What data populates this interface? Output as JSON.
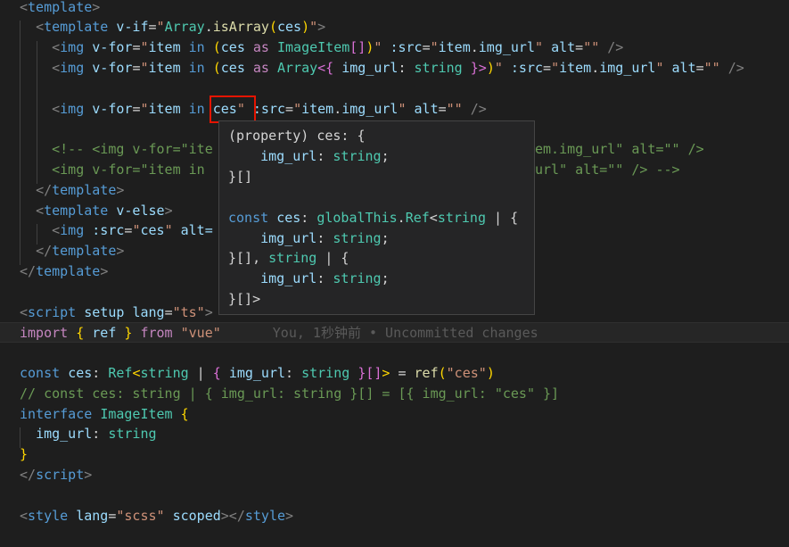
{
  "editor": {
    "lines": [
      [
        [
          "tok-pun",
          "<"
        ],
        [
          "tok-tag",
          "template"
        ],
        [
          "tok-pun",
          ">"
        ]
      ],
      [
        [
          "tok-plain",
          "  "
        ],
        [
          "tok-pun",
          "<"
        ],
        [
          "tok-tag",
          "template"
        ],
        [
          "tok-plain",
          " "
        ],
        [
          "tok-attr",
          "v-if"
        ],
        [
          "tok-plain",
          "="
        ],
        [
          "tok-str",
          "\""
        ],
        [
          "tok-type",
          "Array"
        ],
        [
          "tok-plain",
          "."
        ],
        [
          "tok-fn",
          "isArray"
        ],
        [
          "tok-br1",
          "("
        ],
        [
          "tok-attr",
          "ces"
        ],
        [
          "tok-br1",
          ")"
        ],
        [
          "tok-str",
          "\""
        ],
        [
          "tok-pun",
          ">"
        ]
      ],
      [
        [
          "tok-plain",
          "    "
        ],
        [
          "tok-pun",
          "<"
        ],
        [
          "tok-tag",
          "img"
        ],
        [
          "tok-plain",
          " "
        ],
        [
          "tok-attr",
          "v-for"
        ],
        [
          "tok-plain",
          "="
        ],
        [
          "tok-str",
          "\""
        ],
        [
          "tok-attr",
          "item"
        ],
        [
          "tok-plain",
          " "
        ],
        [
          "tok-kw2",
          "in"
        ],
        [
          "tok-plain",
          " "
        ],
        [
          "tok-br1",
          "("
        ],
        [
          "tok-attr",
          "ces"
        ],
        [
          "tok-plain",
          " "
        ],
        [
          "tok-kw",
          "as"
        ],
        [
          "tok-plain",
          " "
        ],
        [
          "tok-type",
          "ImageItem"
        ],
        [
          "tok-br2",
          "[]"
        ],
        [
          "tok-br1",
          ")"
        ],
        [
          "tok-str",
          "\""
        ],
        [
          "tok-plain",
          " "
        ],
        [
          "tok-attr",
          ":src"
        ],
        [
          "tok-plain",
          "="
        ],
        [
          "tok-str",
          "\""
        ],
        [
          "tok-attr",
          "item"
        ],
        [
          "tok-plain",
          "."
        ],
        [
          "tok-attr",
          "img_url"
        ],
        [
          "tok-str",
          "\""
        ],
        [
          "tok-plain",
          " "
        ],
        [
          "tok-attr",
          "alt"
        ],
        [
          "tok-plain",
          "="
        ],
        [
          "tok-str",
          "\"\""
        ],
        [
          "tok-plain",
          " "
        ],
        [
          "tok-pun",
          "/>"
        ]
      ],
      [
        [
          "tok-plain",
          "    "
        ],
        [
          "tok-pun",
          "<"
        ],
        [
          "tok-tag",
          "img"
        ],
        [
          "tok-plain",
          " "
        ],
        [
          "tok-attr",
          "v-for"
        ],
        [
          "tok-plain",
          "="
        ],
        [
          "tok-str",
          "\""
        ],
        [
          "tok-attr",
          "item"
        ],
        [
          "tok-plain",
          " "
        ],
        [
          "tok-kw2",
          "in"
        ],
        [
          "tok-plain",
          " "
        ],
        [
          "tok-br1",
          "("
        ],
        [
          "tok-attr",
          "ces"
        ],
        [
          "tok-plain",
          " "
        ],
        [
          "tok-kw",
          "as"
        ],
        [
          "tok-plain",
          " "
        ],
        [
          "tok-type",
          "Array"
        ],
        [
          "tok-br2",
          "<{"
        ],
        [
          "tok-plain",
          " "
        ],
        [
          "tok-attr",
          "img_url"
        ],
        [
          "tok-plain",
          ": "
        ],
        [
          "tok-type",
          "string"
        ],
        [
          "tok-plain",
          " "
        ],
        [
          "tok-br2",
          "}>"
        ],
        [
          "tok-br1",
          ")"
        ],
        [
          "tok-str",
          "\""
        ],
        [
          "tok-plain",
          " "
        ],
        [
          "tok-attr",
          ":src"
        ],
        [
          "tok-plain",
          "="
        ],
        [
          "tok-str",
          "\""
        ],
        [
          "tok-attr",
          "item"
        ],
        [
          "tok-plain",
          "."
        ],
        [
          "tok-attr",
          "img_url"
        ],
        [
          "tok-str",
          "\""
        ],
        [
          "tok-plain",
          " "
        ],
        [
          "tok-attr",
          "alt"
        ],
        [
          "tok-plain",
          "="
        ],
        [
          "tok-str",
          "\"\""
        ],
        [
          "tok-plain",
          " "
        ],
        [
          "tok-pun",
          "/>"
        ]
      ],
      [],
      [
        [
          "tok-plain",
          "    "
        ],
        [
          "tok-pun",
          "<"
        ],
        [
          "tok-tag",
          "img"
        ],
        [
          "tok-plain",
          " "
        ],
        [
          "tok-attr",
          "v-for"
        ],
        [
          "tok-plain",
          "="
        ],
        [
          "tok-str",
          "\""
        ],
        [
          "tok-attr",
          "item"
        ],
        [
          "tok-plain",
          " "
        ],
        [
          "tok-kw2",
          "in"
        ],
        [
          "tok-plain",
          " "
        ],
        [
          "tok-attr",
          "ces"
        ],
        [
          "tok-str",
          "\""
        ],
        [
          "tok-plain",
          " "
        ],
        [
          "tok-attr",
          ":src"
        ],
        [
          "tok-plain",
          "="
        ],
        [
          "tok-str",
          "\""
        ],
        [
          "tok-attr",
          "item"
        ],
        [
          "tok-plain",
          "."
        ],
        [
          "tok-attr",
          "img_url"
        ],
        [
          "tok-str",
          "\""
        ],
        [
          "tok-plain",
          " "
        ],
        [
          "tok-attr",
          "alt"
        ],
        [
          "tok-plain",
          "="
        ],
        [
          "tok-str",
          "\"\""
        ],
        [
          "tok-plain",
          " "
        ],
        [
          "tok-pun",
          "/>"
        ]
      ],
      [],
      [
        [
          "tok-plain",
          "    "
        ],
        [
          "tok-cmt",
          "<!-- <img v-for=\"ite"
        ],
        [
          "tok-plain",
          "                                 "
        ],
        [
          "tok-cmt",
          "src=\"item.img_url\" alt=\"\" />"
        ]
      ],
      [
        [
          "tok-plain",
          "    "
        ],
        [
          "tok-cmt",
          "<img v-for=\"item in "
        ],
        [
          "tok-plain",
          "                                 "
        ],
        [
          "tok-cmt",
          "em.img_url\" alt=\"\" /> -->"
        ]
      ],
      [
        [
          "tok-plain",
          "  "
        ],
        [
          "tok-pun",
          "</"
        ],
        [
          "tok-tag",
          "template"
        ],
        [
          "tok-pun",
          ">"
        ]
      ],
      [
        [
          "tok-plain",
          "  "
        ],
        [
          "tok-pun",
          "<"
        ],
        [
          "tok-tag",
          "template"
        ],
        [
          "tok-plain",
          " "
        ],
        [
          "tok-attr",
          "v-else"
        ],
        [
          "tok-pun",
          ">"
        ]
      ],
      [
        [
          "tok-plain",
          "    "
        ],
        [
          "tok-pun",
          "<"
        ],
        [
          "tok-tag",
          "img"
        ],
        [
          "tok-plain",
          " "
        ],
        [
          "tok-attr",
          ":src"
        ],
        [
          "tok-plain",
          "="
        ],
        [
          "tok-str",
          "\""
        ],
        [
          "tok-attr",
          "ces"
        ],
        [
          "tok-str",
          "\""
        ],
        [
          "tok-plain",
          " "
        ],
        [
          "tok-attr",
          "alt="
        ]
      ],
      [
        [
          "tok-plain",
          "  "
        ],
        [
          "tok-pun",
          "</"
        ],
        [
          "tok-tag",
          "template"
        ],
        [
          "tok-pun",
          ">"
        ]
      ],
      [
        [
          "tok-pun",
          "</"
        ],
        [
          "tok-tag",
          "template"
        ],
        [
          "tok-pun",
          ">"
        ]
      ],
      [],
      [
        [
          "tok-pun",
          "<"
        ],
        [
          "tok-tag",
          "script"
        ],
        [
          "tok-plain",
          " "
        ],
        [
          "tok-attr",
          "setup"
        ],
        [
          "tok-plain",
          " "
        ],
        [
          "tok-attr",
          "lang"
        ],
        [
          "tok-plain",
          "="
        ],
        [
          "tok-str",
          "\"ts\""
        ],
        [
          "tok-pun",
          ">"
        ]
      ],
      [
        [
          "tok-kw",
          "import"
        ],
        [
          "tok-plain",
          " "
        ],
        [
          "tok-br1",
          "{"
        ],
        [
          "tok-plain",
          " "
        ],
        [
          "tok-attr",
          "ref"
        ],
        [
          "tok-plain",
          " "
        ],
        [
          "tok-br1",
          "}"
        ],
        [
          "tok-plain",
          " "
        ],
        [
          "tok-kw",
          "from"
        ],
        [
          "tok-plain",
          " "
        ],
        [
          "tok-str",
          "\"vue\""
        ],
        [
          "blame",
          "You, 1秒钟前 • Uncommitted changes"
        ]
      ],
      [],
      [
        [
          "tok-kw2",
          "const"
        ],
        [
          "tok-plain",
          " "
        ],
        [
          "tok-attr",
          "ces"
        ],
        [
          "tok-plain",
          ": "
        ],
        [
          "tok-type",
          "Ref"
        ],
        [
          "tok-br1",
          "<"
        ],
        [
          "tok-type",
          "string"
        ],
        [
          "tok-plain",
          " | "
        ],
        [
          "tok-br2",
          "{"
        ],
        [
          "tok-plain",
          " "
        ],
        [
          "tok-attr",
          "img_url"
        ],
        [
          "tok-plain",
          ": "
        ],
        [
          "tok-type",
          "string"
        ],
        [
          "tok-plain",
          " "
        ],
        [
          "tok-br2",
          "}"
        ],
        [
          "tok-br2",
          "[]"
        ],
        [
          "tok-br1",
          ">"
        ],
        [
          "tok-plain",
          " = "
        ],
        [
          "tok-fn",
          "ref"
        ],
        [
          "tok-br1",
          "("
        ],
        [
          "tok-str",
          "\"ces\""
        ],
        [
          "tok-br1",
          ")"
        ]
      ],
      [
        [
          "tok-cmt",
          "// const ces: string | { img_url: string }[] = [{ img_url: \"ces\" }]"
        ]
      ],
      [
        [
          "tok-kw2",
          "interface"
        ],
        [
          "tok-plain",
          " "
        ],
        [
          "tok-type",
          "ImageItem"
        ],
        [
          "tok-plain",
          " "
        ],
        [
          "tok-br1",
          "{"
        ]
      ],
      [
        [
          "tok-plain",
          "  "
        ],
        [
          "tok-attr",
          "img_url"
        ],
        [
          "tok-plain",
          ": "
        ],
        [
          "tok-type",
          "string"
        ]
      ],
      [
        [
          "tok-br1",
          "}"
        ]
      ],
      [
        [
          "tok-pun",
          "</"
        ],
        [
          "tok-tag",
          "script"
        ],
        [
          "tok-pun",
          ">"
        ]
      ],
      [],
      [
        [
          "tok-pun",
          "<"
        ],
        [
          "tok-tag",
          "style"
        ],
        [
          "tok-plain",
          " "
        ],
        [
          "tok-attr",
          "lang"
        ],
        [
          "tok-plain",
          "="
        ],
        [
          "tok-str",
          "\"scss\""
        ],
        [
          "tok-plain",
          " "
        ],
        [
          "tok-attr",
          "scoped"
        ],
        [
          "tok-pun",
          "></"
        ],
        [
          "tok-tag",
          "style"
        ],
        [
          "tok-pun",
          ">"
        ]
      ]
    ]
  },
  "hover": {
    "lines": [
      [
        [
          "tok-plain",
          "(property) ces: {"
        ]
      ],
      [
        [
          "tok-plain",
          "    "
        ],
        [
          "tok-attr",
          "img_url"
        ],
        [
          "tok-plain",
          ": "
        ],
        [
          "tok-type",
          "string"
        ],
        [
          "tok-plain",
          ";"
        ]
      ],
      [
        [
          "tok-plain",
          "}[]"
        ]
      ],
      [],
      [
        [
          "tok-kw2",
          "const"
        ],
        [
          "tok-plain",
          " "
        ],
        [
          "tok-attr",
          "ces"
        ],
        [
          "tok-plain",
          ": "
        ],
        [
          "tok-type",
          "globalThis"
        ],
        [
          "tok-plain",
          "."
        ],
        [
          "tok-type",
          "Ref"
        ],
        [
          "tok-plain",
          "<"
        ],
        [
          "tok-type",
          "string"
        ],
        [
          "tok-plain",
          " | {"
        ]
      ],
      [
        [
          "tok-plain",
          "    "
        ],
        [
          "tok-attr",
          "img_url"
        ],
        [
          "tok-plain",
          ": "
        ],
        [
          "tok-type",
          "string"
        ],
        [
          "tok-plain",
          ";"
        ]
      ],
      [
        [
          "tok-plain",
          "}[], "
        ],
        [
          "tok-type",
          "string"
        ],
        [
          "tok-plain",
          " | {"
        ]
      ],
      [
        [
          "tok-plain",
          "    "
        ],
        [
          "tok-attr",
          "img_url"
        ],
        [
          "tok-plain",
          ": "
        ],
        [
          "tok-type",
          "string"
        ],
        [
          "tok-plain",
          ";"
        ]
      ],
      [
        [
          "tok-plain",
          "}[]>"
        ]
      ]
    ]
  }
}
